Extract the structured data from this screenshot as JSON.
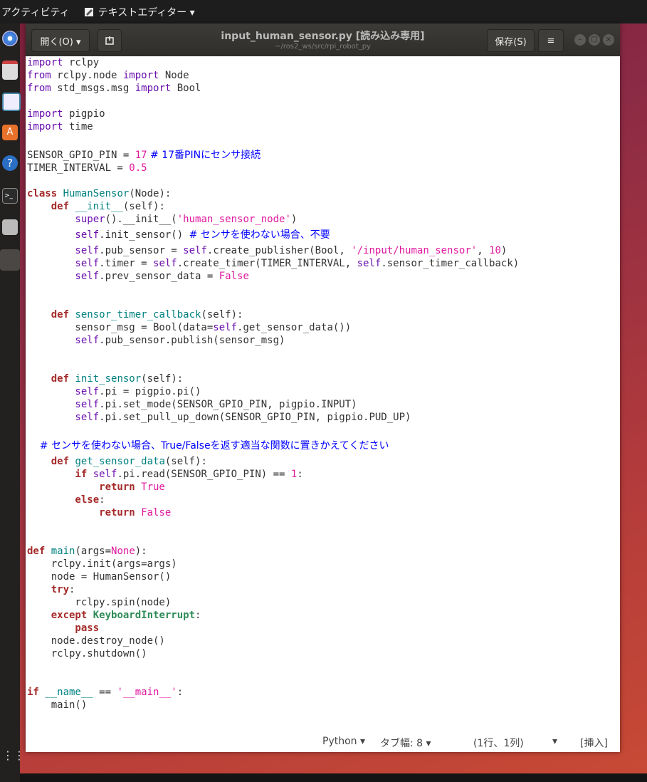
{
  "topbar": {
    "activities": "アクティビティ",
    "app_menu": "テキストエディター ▾"
  },
  "header": {
    "open_label": "開く(O) ▾",
    "title": "input_human_sensor.py [読み込み専用]",
    "subtitle": "~/ros2_ws/src/rpi_robot_py",
    "save_label": "保存(S)",
    "menu_icon": "≡"
  },
  "status": {
    "language": "Python ▾",
    "tab_width": "タブ幅: 8 ▾",
    "position": "(1行、1列)",
    "position_dropdown": "▾",
    "mode": "[挿入]"
  },
  "code": {
    "l1a": "import",
    "l1b": " rclpy",
    "l2a": "from",
    "l2b": " rclpy.node ",
    "l2c": "import",
    "l2d": " Node",
    "l3a": "from",
    "l3b": " std_msgs.msg ",
    "l3c": "import",
    "l3d": " Bool",
    "l5a": "import",
    "l5b": " pigpio",
    "l6a": "import",
    "l6b": " time",
    "l8a": "SENSOR_GPIO_PIN = ",
    "l8b": "17",
    "l8c": " # 17番PINにセンサ接続",
    "l9a": "TIMER_INTERVAL = ",
    "l9b": "0.5",
    "l11a": "class",
    "l11b": " HumanSensor",
    "l11c": "(Node):",
    "l12a": "    def",
    "l12b": " __init__",
    "l12c": "(self):",
    "l13a": "        super",
    "l13b": "().__init__(",
    "l13c": "'human_sensor_node'",
    "l13d": ")",
    "l14a": "        self",
    "l14b": ".init_sensor() ",
    "l14c": "# センサを使わない場合、不要",
    "l15a": "        self",
    "l15b": ".pub_sensor = ",
    "l15c": "self",
    "l15d": ".create_publisher(Bool, ",
    "l15e": "'/input/human_sensor'",
    "l15f": ", ",
    "l15g": "10",
    "l15h": ")",
    "l16a": "        self",
    "l16b": ".timer = ",
    "l16c": "self",
    "l16d": ".create_timer(TIMER_INTERVAL, ",
    "l16e": "self",
    "l16f": ".sensor_timer_callback)",
    "l17a": "        self",
    "l17b": ".prev_sensor_data = ",
    "l17c": "False",
    "l20a": "    def",
    "l20b": " sensor_timer_callback",
    "l20c": "(self):",
    "l21a": "        sensor_msg = Bool(data=",
    "l21b": "self",
    "l21c": ".get_sensor_data())",
    "l22a": "        self",
    "l22b": ".pub_sensor.publish(sensor_msg)",
    "l25a": "    def",
    "l25b": " init_sensor",
    "l25c": "(self):",
    "l26a": "        self",
    "l26b": ".pi = pigpio.pi()",
    "l27a": "        self",
    "l27b": ".pi.set_mode(SENSOR_GPIO_PIN, pigpio.INPUT)",
    "l28a": "        self",
    "l28b": ".pi.set_pull_up_down(SENSOR_GPIO_PIN, pigpio.PUD_UP)",
    "l30a": "    # センサを使わない場合、True/Falseを返す適当な関数に置きかえてください",
    "l31a": "    def",
    "l31b": " get_sensor_data",
    "l31c": "(self):",
    "l32a": "        if",
    "l32b": " self",
    "l32c": ".pi.read(SENSOR_GPIO_PIN) == ",
    "l32d": "1",
    "l32e": ":",
    "l33a": "            return",
    "l33b": " True",
    "l34a": "        else",
    "l34b": ":",
    "l35a": "            return",
    "l35b": " False",
    "l38a": "def",
    "l38b": " main",
    "l38c": "(args=",
    "l38d": "None",
    "l38e": "):",
    "l39a": "    rclpy.init(args=args)",
    "l40a": "    node = HumanSensor()",
    "l41a": "    try",
    "l41b": ":",
    "l42a": "        rclpy.spin(node)",
    "l43a": "    except",
    "l43b": " KeyboardInterrupt",
    "l43c": ":",
    "l44a": "        pass",
    "l45a": "    node.destroy_node()",
    "l46a": "    rclpy.shutdown()",
    "l49a": "if",
    "l49b": " __name__",
    "l49c": " == ",
    "l49d": "'__main__'",
    "l49e": ":",
    "l50a": "    main()"
  }
}
